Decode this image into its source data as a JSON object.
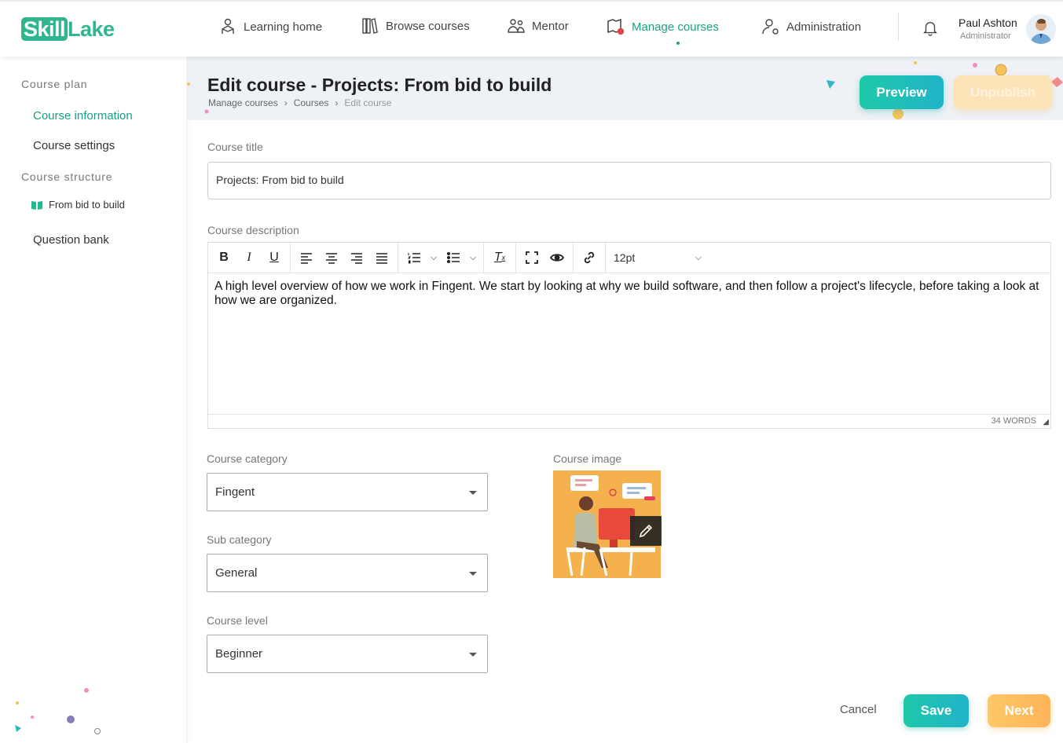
{
  "brand": {
    "part1": "Skill",
    "part2": "Lake"
  },
  "nav": {
    "items": [
      {
        "label": "Learning home"
      },
      {
        "label": "Browse courses"
      },
      {
        "label": "Mentor"
      },
      {
        "label": "Manage courses"
      },
      {
        "label": "Administration"
      }
    ]
  },
  "user": {
    "name": "Paul Ashton",
    "role": "Administrator"
  },
  "sidebar": {
    "course_plan": "Course plan",
    "course_information": "Course information",
    "course_settings": "Course settings",
    "course_structure": "Course structure",
    "module": "From bid to build",
    "question_bank": "Question bank"
  },
  "header": {
    "title": "Edit course - Projects: From bid to build",
    "breadcrumb": [
      "Manage courses",
      "Courses",
      "Edit course"
    ],
    "preview": "Preview",
    "unpublish": "Unpublish"
  },
  "form": {
    "title_label": "Course title",
    "title_value": "Projects: From bid to build",
    "description_label": "Course description",
    "description_value": "A high level overview of how we work in Fingent. We start by looking at why we build software, and then follow a project's lifecycle, before taking a look at how we are organized.",
    "font_size": "12pt",
    "word_count": "34 WORDS",
    "category_label": "Course category",
    "category_value": "Fingent",
    "subcategory_label": "Sub category",
    "subcategory_value": "General",
    "level_label": "Course level",
    "level_value": "Beginner",
    "image_label": "Course image"
  },
  "footer": {
    "cancel": "Cancel",
    "save": "Save",
    "next": "Next"
  },
  "colors": {
    "accent": "#1aa286",
    "teal": "#20b3c8",
    "orange": "#fdb45a"
  }
}
